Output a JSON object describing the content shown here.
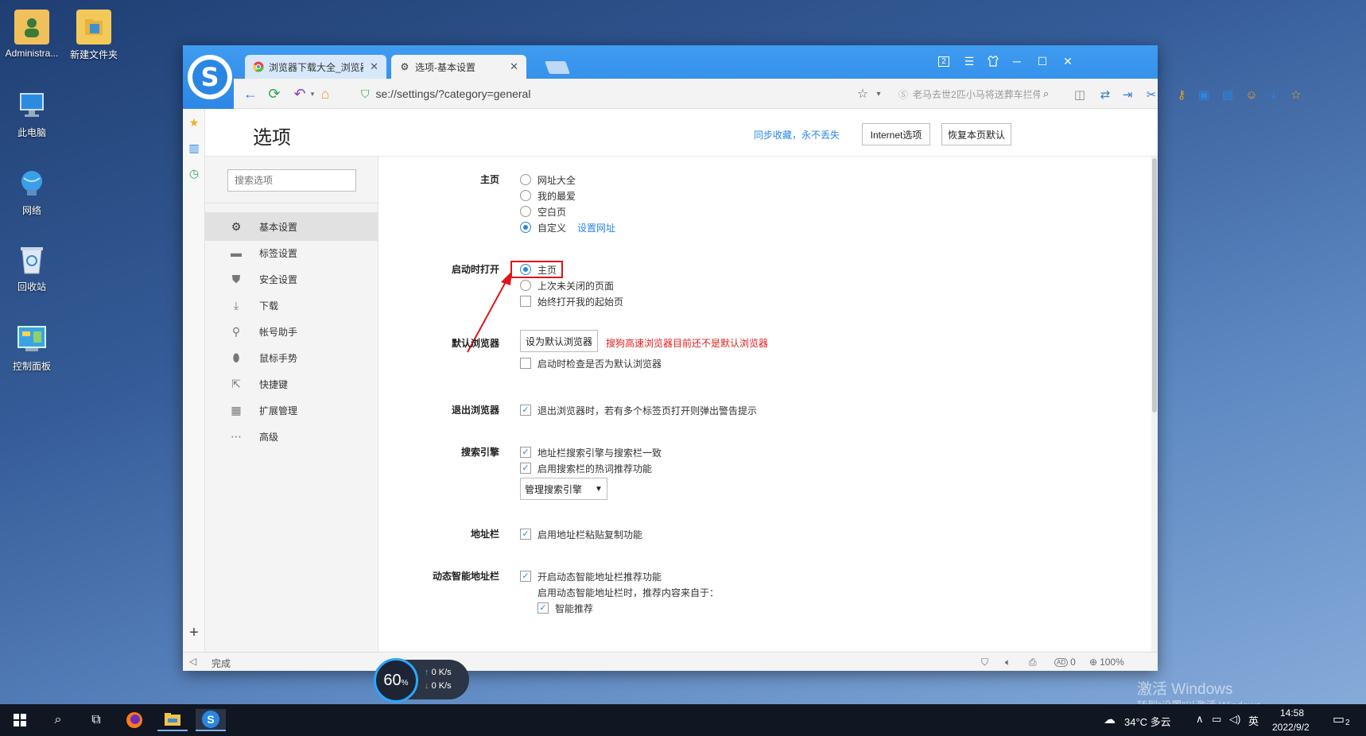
{
  "desktop": {
    "icons": [
      {
        "label": "Administra...",
        "icon": "user-folder-icon"
      },
      {
        "label": "新建文件夹",
        "icon": "folder-icon"
      },
      {
        "label": "此电脑",
        "icon": "computer-icon"
      },
      {
        "label": "网络",
        "icon": "network-icon"
      },
      {
        "label": "回收站",
        "icon": "recycle-bin-icon"
      },
      {
        "label": "控制面板",
        "icon": "control-panel-icon"
      }
    ]
  },
  "browser": {
    "tabs": [
      {
        "title": "浏览器下载大全_浏览器",
        "icon": "chrome-icon"
      },
      {
        "title": "选项-基本设置",
        "icon": "gear-icon"
      }
    ],
    "address": "se://settings/?category=general",
    "search_placeholder": "老马去世2匹小马将送葬车拦停",
    "badge_number": "2"
  },
  "page": {
    "title": "选项",
    "sync_link": "同步收藏，永不丢失",
    "internet_options_btn": "Internet选项",
    "restore_defaults_btn": "恢复本页默认",
    "search_placeholder": "搜索选项"
  },
  "nav": {
    "items": [
      {
        "label": "基本设置",
        "icon": "gear-icon"
      },
      {
        "label": "标签设置",
        "icon": "tab-icon"
      },
      {
        "label": "安全设置",
        "icon": "shield-icon"
      },
      {
        "label": "下载",
        "icon": "download-icon"
      },
      {
        "label": "帐号助手",
        "icon": "key-icon"
      },
      {
        "label": "鼠标手势",
        "icon": "mouse-icon"
      },
      {
        "label": "快捷键",
        "icon": "shortcut-icon"
      },
      {
        "label": "扩展管理",
        "icon": "extensions-icon"
      },
      {
        "label": "高级",
        "icon": "more-icon"
      }
    ]
  },
  "settings": {
    "homepage": {
      "label": "主页",
      "options": [
        "网址大全",
        "我的最爱",
        "空白页",
        "自定义"
      ],
      "selected": "自定义",
      "link": "设置网址"
    },
    "startup": {
      "label": "启动时打开",
      "options": [
        "主页",
        "上次未关闭的页面"
      ],
      "selected": "主页",
      "checkbox": "始终打开我的起始页"
    },
    "default_browser": {
      "label": "默认浏览器",
      "button": "设为默认浏览器",
      "warning": "搜狗高速浏览器目前还不是默认浏览器",
      "checkbox": "启动时检查是否为默认浏览器"
    },
    "exit": {
      "label": "退出浏览器",
      "checkbox": "退出浏览器时，若有多个标签页打开则弹出警告提示"
    },
    "search_engine": {
      "label": "搜索引擎",
      "checkboxes": [
        "地址栏搜索引擎与搜索栏一致",
        "启用搜索栏的热词推荐功能"
      ],
      "button": "管理搜索引擎"
    },
    "address_bar": {
      "label": "地址栏",
      "checkbox": "启用地址栏粘贴复制功能"
    },
    "smart_address": {
      "label": "动态智能地址栏",
      "checkbox": "开启动态智能地址栏推荐功能",
      "note": "启用动态智能地址栏时，推荐内容来自于：",
      "sub_checkbox": "智能推荐"
    }
  },
  "status": {
    "text": "完成",
    "ad_count": "0",
    "zoom": "100%"
  },
  "speed_widget": {
    "percent": "60",
    "unit": "%",
    "up": "0 K/s",
    "down": "0 K/s"
  },
  "taskbar": {
    "weather": "34°C 多云",
    "ime": "英",
    "time": "14:58",
    "date": "2022/9/2",
    "notification_count": "2"
  },
  "watermark": {
    "line1": "激活 Windows",
    "line2": "转到“设置”以激活 Windows。"
  },
  "colors": {
    "accent": "#2a86e3",
    "highlight_box": "#e0121a",
    "warning": "#e02020"
  }
}
